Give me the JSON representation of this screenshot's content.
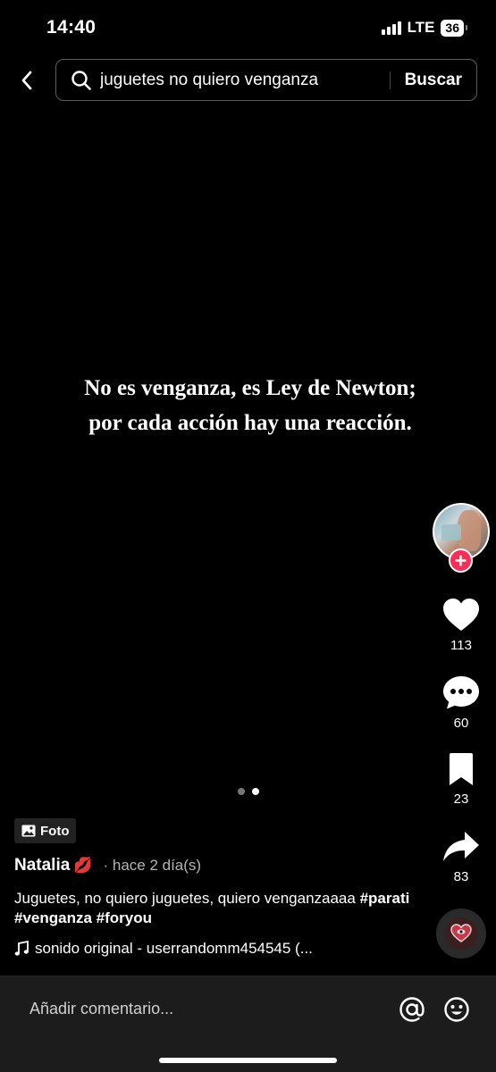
{
  "status_bar": {
    "time": "14:40",
    "network": "LTE",
    "battery": "36"
  },
  "search": {
    "query": "juguetes no quiero venganza",
    "button_label": "Buscar"
  },
  "post": {
    "slide_text": "No es venganza, es Ley de Newton; por cada acción hay una reacción.",
    "slide_count": 2,
    "active_slide": 2,
    "type_badge": "Foto",
    "author": "Natalia",
    "author_emoji": "💋",
    "time_ago": "· hace 2 día(s)",
    "caption_text": "Juguetes, no quiero juguetes, quiero venganzaaaa ",
    "hashtags": [
      "#parati",
      "#venganza",
      "#foryou"
    ],
    "sound": "sonido original - userrandomm454545 (..."
  },
  "actions": {
    "likes": "113",
    "comments": "60",
    "saves": "23",
    "shares": "83"
  },
  "comment_bar": {
    "placeholder": "Añadir comentario..."
  },
  "colors": {
    "background": "#000000",
    "follow_accent": "#fe2c55",
    "comment_bar": "#1c1c1c"
  },
  "icons": [
    "back-icon",
    "search-icon",
    "plus-icon",
    "heart-icon",
    "comment-icon",
    "bookmark-icon",
    "share-icon",
    "image-icon",
    "music-note-icon",
    "at-icon",
    "emoji-icon"
  ]
}
